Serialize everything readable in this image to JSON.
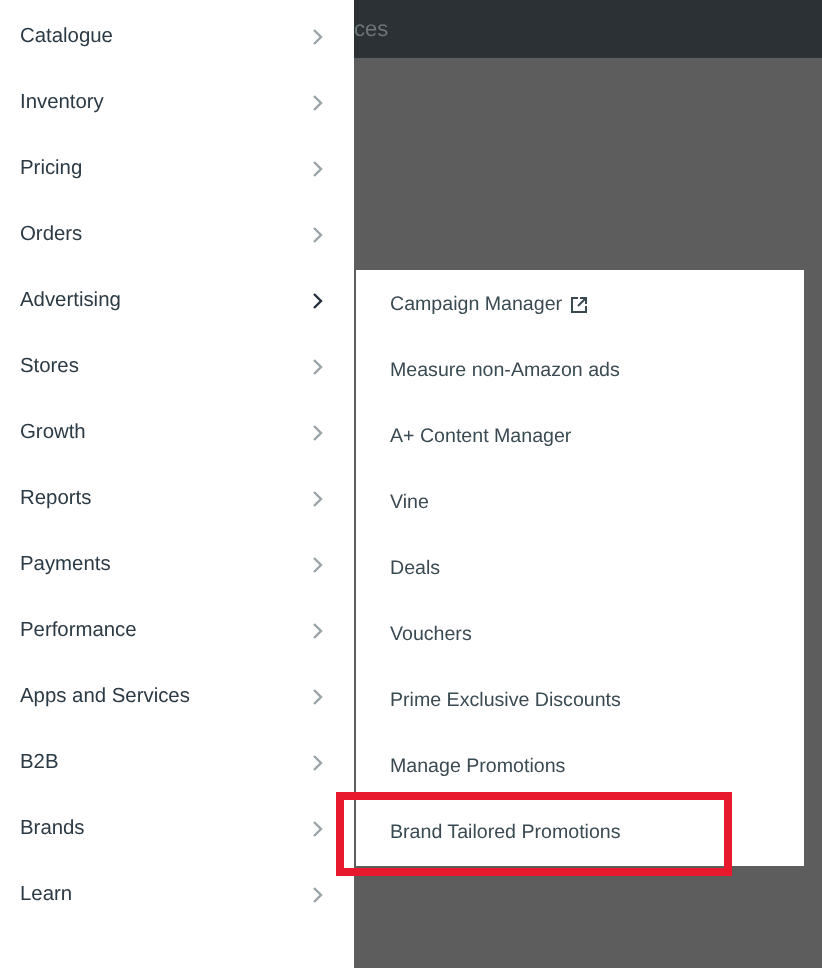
{
  "background": {
    "header_fragment": "ces"
  },
  "menu": {
    "items": [
      {
        "label": "Catalogue",
        "selected": false
      },
      {
        "label": "Inventory",
        "selected": false
      },
      {
        "label": "Pricing",
        "selected": false
      },
      {
        "label": "Orders",
        "selected": false
      },
      {
        "label": "Advertising",
        "selected": true
      },
      {
        "label": "Stores",
        "selected": false
      },
      {
        "label": "Growth",
        "selected": false
      },
      {
        "label": "Reports",
        "selected": false
      },
      {
        "label": "Payments",
        "selected": false
      },
      {
        "label": "Performance",
        "selected": false
      },
      {
        "label": "Apps and Services",
        "selected": false
      },
      {
        "label": "B2B",
        "selected": false
      },
      {
        "label": "Brands",
        "selected": false
      },
      {
        "label": "Learn",
        "selected": false
      }
    ]
  },
  "submenu": {
    "items": [
      {
        "label": "Campaign Manager",
        "external": true,
        "highlighted": false
      },
      {
        "label": "Measure non-Amazon ads",
        "external": false,
        "highlighted": false
      },
      {
        "label": "A+ Content Manager",
        "external": false,
        "highlighted": false
      },
      {
        "label": "Vine",
        "external": false,
        "highlighted": false
      },
      {
        "label": "Deals",
        "external": false,
        "highlighted": false
      },
      {
        "label": "Vouchers",
        "external": false,
        "highlighted": false
      },
      {
        "label": "Prime Exclusive Discounts",
        "external": false,
        "highlighted": false
      },
      {
        "label": "Manage Promotions",
        "external": false,
        "highlighted": false
      },
      {
        "label": "Brand Tailored Promotions",
        "external": false,
        "highlighted": true
      }
    ]
  }
}
